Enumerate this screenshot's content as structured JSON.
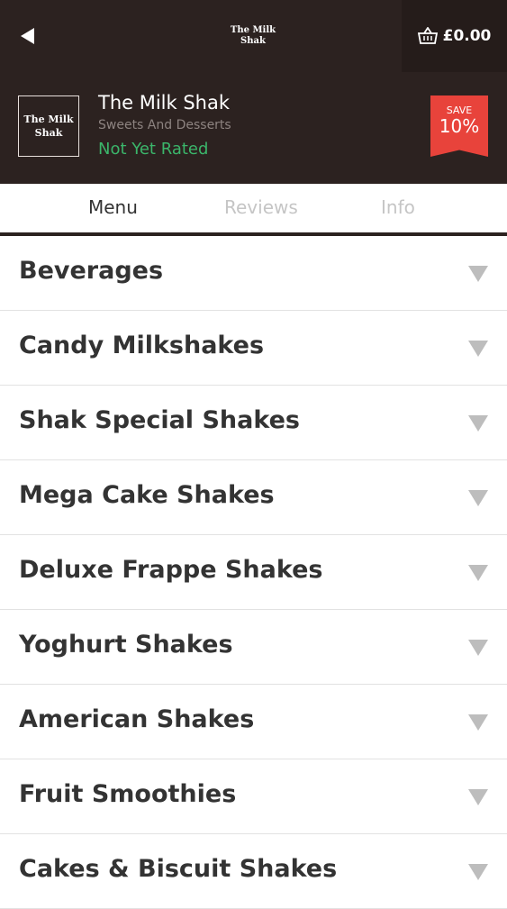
{
  "topbar": {
    "logo_line1": "The Milk",
    "logo_line2": "Shak",
    "basket_total": "£0.00",
    "icons": [
      "back-arrow-icon",
      "basket-icon"
    ]
  },
  "restaurant": {
    "logo_line1": "The Milk",
    "logo_line2": "Shak",
    "name": "The Milk Shak",
    "cuisine": "Sweets And Desserts",
    "rating": "Not Yet Rated",
    "save_label": "SAVE",
    "save_value": "10%"
  },
  "tabs": [
    {
      "label": "Menu",
      "active": true
    },
    {
      "label": "Reviews",
      "active": false
    },
    {
      "label": "Info",
      "active": false
    }
  ],
  "categories": [
    "Beverages",
    "Candy Milkshakes",
    "Shak Special Shakes",
    "Mega Cake Shakes",
    "Deluxe Frappe Shakes",
    "Yoghurt Shakes",
    "American Shakes",
    "Fruit Smoothies",
    "Cakes & Biscuit Shakes"
  ],
  "colors": {
    "header_bg": "#2c2220",
    "basket_bg": "#251c1a",
    "rating_green": "#3bb56a",
    "save_red": "#e8433b",
    "text_dark": "#333333",
    "tab_inactive": "#c5c5c5"
  }
}
